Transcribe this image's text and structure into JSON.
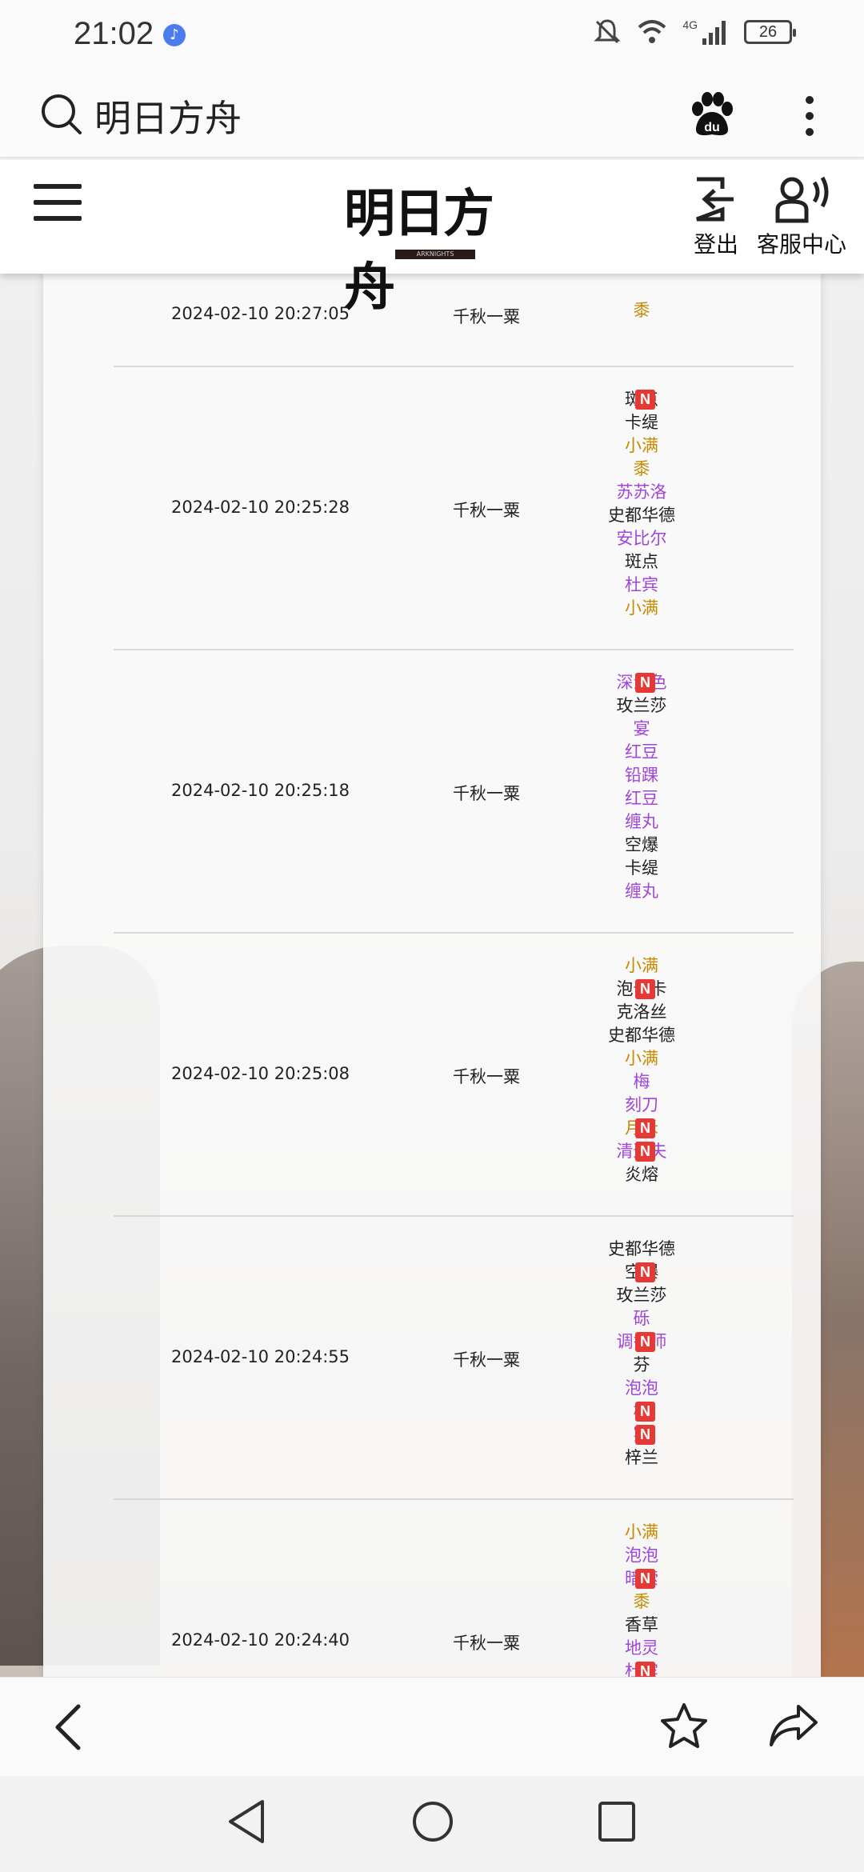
{
  "status_bar": {
    "time": "21:02",
    "battery": "26",
    "network": "4G"
  },
  "search": {
    "query": "明日方舟"
  },
  "header": {
    "logo_text": "明日方舟",
    "logo_sub": "ARKNIGHTS",
    "logout_label": "登出",
    "service_label": "客服中心"
  },
  "colors": {
    "black": "#222222",
    "gold": "#c58a00",
    "purple": "#a046d8",
    "badge": "#e53935"
  },
  "records": [
    {
      "date": "2024-02-10 20:27:05",
      "user": "千秋一粟",
      "ops": [
        {
          "name": "黍",
          "color": "gold"
        }
      ]
    },
    {
      "date": "2024-02-10 20:25:28",
      "user": "千秋一粟",
      "ops": [
        {
          "name": "斑点",
          "color": "black",
          "new": true
        },
        {
          "name": "卡缇",
          "color": "black"
        },
        {
          "name": "小满",
          "color": "gold"
        },
        {
          "name": "黍",
          "color": "gold"
        },
        {
          "name": "苏苏洛",
          "color": "purple"
        },
        {
          "name": "史都华德",
          "color": "black"
        },
        {
          "name": "安比尔",
          "color": "purple"
        },
        {
          "name": "斑点",
          "color": "black"
        },
        {
          "name": "杜宾",
          "color": "purple"
        },
        {
          "name": "小满",
          "color": "gold"
        }
      ]
    },
    {
      "date": "2024-02-10 20:25:18",
      "user": "千秋一粟",
      "ops": [
        {
          "name": "深海色",
          "color": "purple",
          "new": true
        },
        {
          "name": "玫兰莎",
          "color": "black"
        },
        {
          "name": "宴",
          "color": "purple"
        },
        {
          "name": "红豆",
          "color": "purple"
        },
        {
          "name": "铅踝",
          "color": "purple"
        },
        {
          "name": "红豆",
          "color": "purple"
        },
        {
          "name": "缠丸",
          "color": "purple"
        },
        {
          "name": "空爆",
          "color": "black"
        },
        {
          "name": "卡缇",
          "color": "black"
        },
        {
          "name": "缠丸",
          "color": "purple"
        }
      ]
    },
    {
      "date": "2024-02-10 20:25:08",
      "user": "千秋一粟",
      "ops": [
        {
          "name": "小满",
          "color": "gold"
        },
        {
          "name": "泡普卡",
          "color": "black",
          "new": true
        },
        {
          "name": "克洛丝",
          "color": "black"
        },
        {
          "name": "史都华德",
          "color": "black"
        },
        {
          "name": "小满",
          "color": "gold"
        },
        {
          "name": "梅",
          "color": "purple"
        },
        {
          "name": "刻刀",
          "color": "purple"
        },
        {
          "name": "月禾",
          "color": "gold",
          "new": true
        },
        {
          "name": "清道夫",
          "color": "purple",
          "new": true
        },
        {
          "name": "炎熔",
          "color": "black"
        }
      ]
    },
    {
      "date": "2024-02-10 20:24:55",
      "user": "千秋一粟",
      "ops": [
        {
          "name": "史都华德",
          "color": "black"
        },
        {
          "name": "空爆",
          "color": "black",
          "new": true
        },
        {
          "name": "玫兰莎",
          "color": "black"
        },
        {
          "name": "砾",
          "color": "purple"
        },
        {
          "name": "调香师",
          "color": "purple",
          "new": true
        },
        {
          "name": "芬",
          "color": "black"
        },
        {
          "name": "泡泡",
          "color": "purple"
        },
        {
          "name": "梅",
          "color": "purple",
          "new": true
        },
        {
          "name": "宴",
          "color": "purple",
          "new": true
        },
        {
          "name": "梓兰",
          "color": "black"
        }
      ]
    },
    {
      "date": "2024-02-10 20:24:40",
      "user": "千秋一粟",
      "ops": [
        {
          "name": "小满",
          "color": "gold"
        },
        {
          "name": "泡泡",
          "color": "purple"
        },
        {
          "name": "暗索",
          "color": "purple",
          "new": true
        },
        {
          "name": "黍",
          "color": "gold"
        },
        {
          "name": "香草",
          "color": "black"
        },
        {
          "name": "地灵",
          "color": "purple"
        },
        {
          "name": "杜宾",
          "color": "purple",
          "new": true
        }
      ]
    }
  ],
  "badge_label": "N"
}
